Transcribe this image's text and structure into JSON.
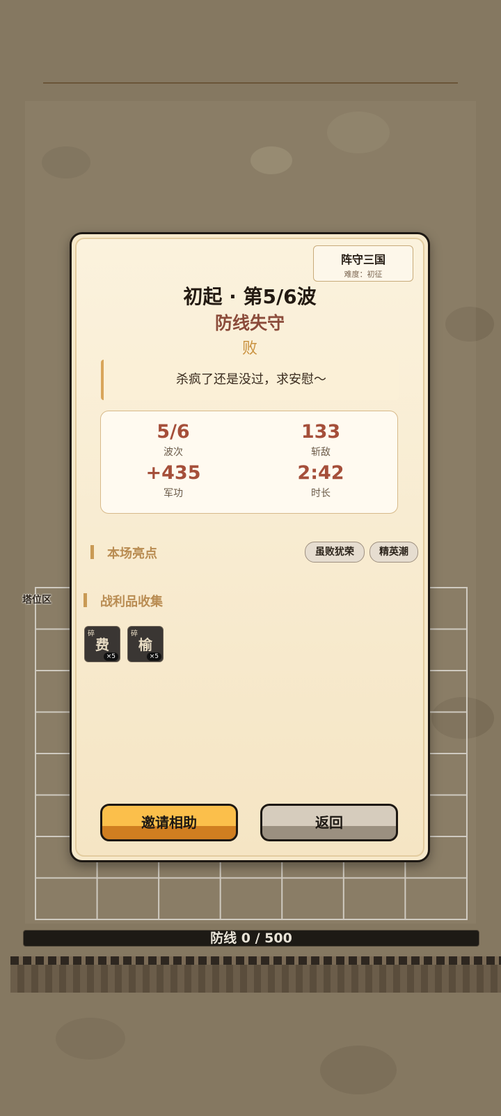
{
  "game": {
    "tower_zone_label": "塔位区",
    "defense_bar": {
      "text": "防线 0 / 500",
      "current": 0,
      "max": 500
    }
  },
  "modal": {
    "badge": {
      "title": "阵守三国",
      "subtitle": "难度：初征"
    },
    "title": "初起 · 第5/6波",
    "subtitle": "防线失守",
    "result": "败",
    "quote": "杀疯了还是没过，求安慰～",
    "stats": [
      {
        "value": "5/6",
        "label": "波次"
      },
      {
        "value": "133",
        "label": "斩敌"
      },
      {
        "value": "+435",
        "label": "军功"
      },
      {
        "value": "2:42",
        "label": "时长"
      }
    ],
    "highlights": {
      "heading": "本场亮点",
      "tags": [
        "虽败犹荣",
        "精英潮"
      ]
    },
    "loot": {
      "heading": "战利品收集",
      "items": [
        {
          "shard": "碎",
          "char": "费",
          "count": "×5"
        },
        {
          "shard": "碎",
          "char": "榆",
          "count": "×5"
        }
      ]
    },
    "buttons": {
      "invite": "邀请相助",
      "back": "返回"
    }
  },
  "colors": {
    "accent": "#fbbf4b",
    "title_red": "#8b4b3a",
    "stat_red": "#a54f3a",
    "gold": "#c9913e"
  }
}
